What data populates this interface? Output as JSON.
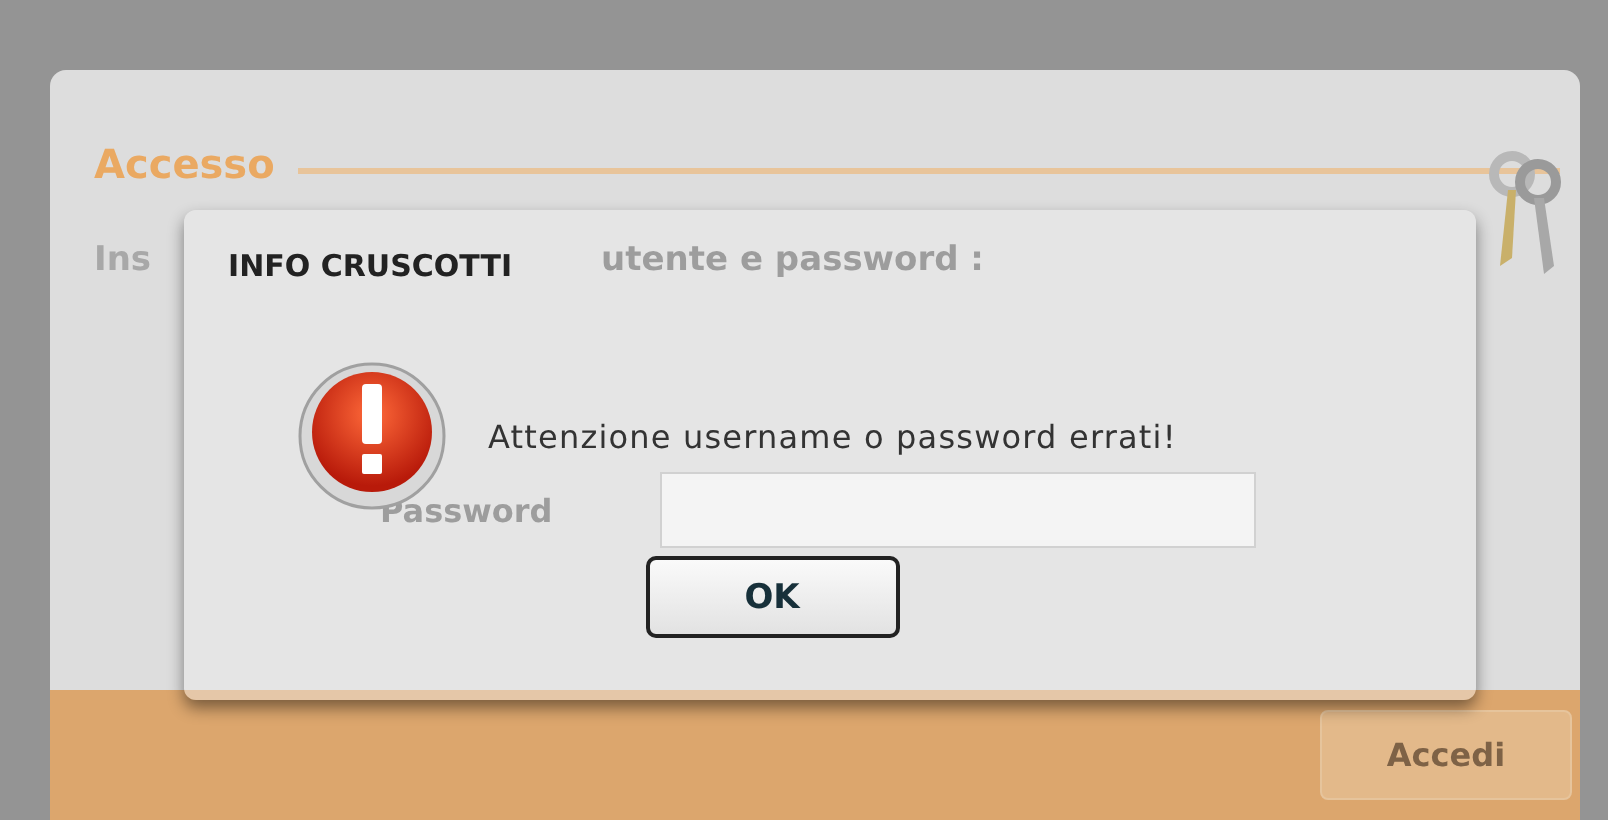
{
  "login_panel": {
    "title": "Accesso",
    "instruction_parts": [
      "Ins",
      "utente e password :"
    ],
    "password_label": "Password",
    "submit_button": "Accedi"
  },
  "dialog": {
    "title": "INFO CRUSCOTTI",
    "message": "Attenzione username o password errati!",
    "button": "OK"
  }
}
